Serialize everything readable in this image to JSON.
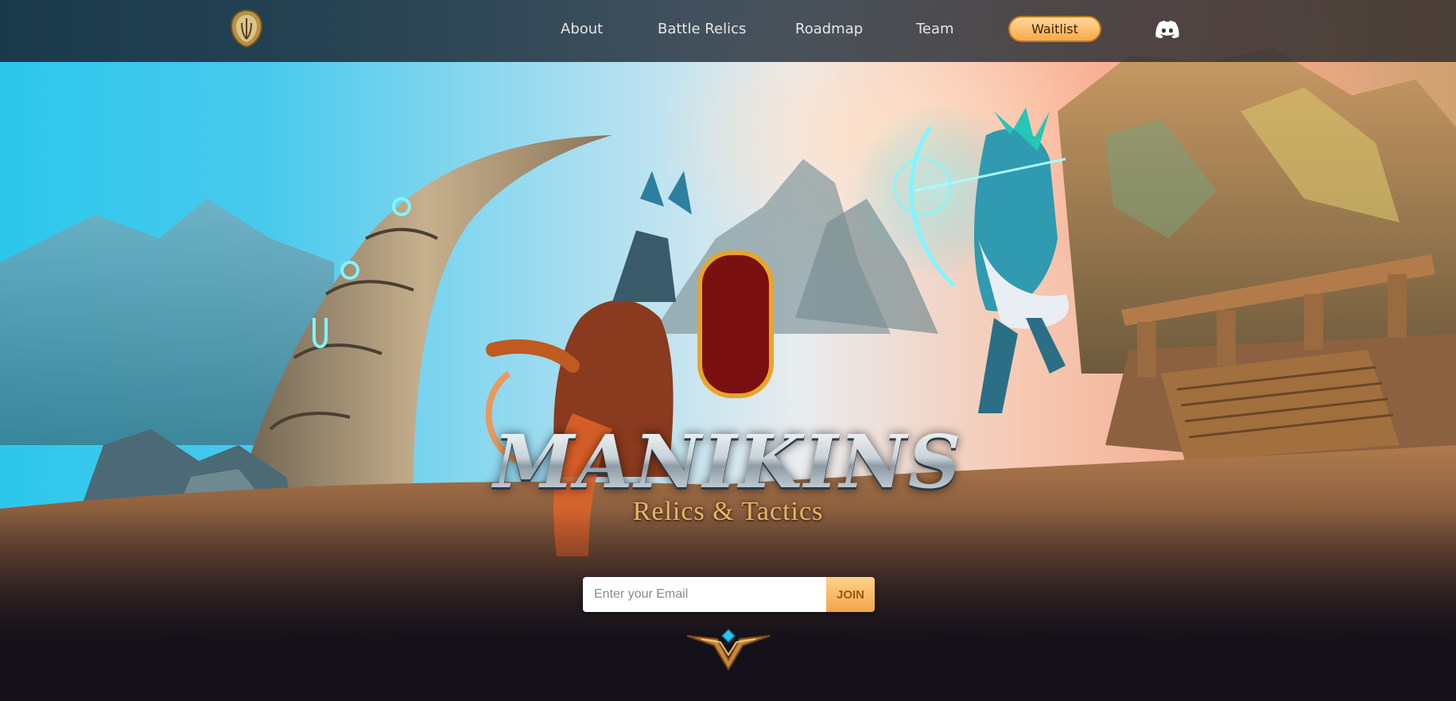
{
  "nav": {
    "logo_icon": "shield-emblem-icon",
    "links": [
      {
        "label": "About"
      },
      {
        "label": "Battle Relics"
      },
      {
        "label": "Roadmap"
      },
      {
        "label": "Team"
      }
    ],
    "waitlist_label": "Waitlist",
    "discord_icon": "discord-icon"
  },
  "hero": {
    "title": "MANIKINS",
    "subtitle": "Relics & Tactics"
  },
  "signup": {
    "email_placeholder": "Enter your Email",
    "email_value": "",
    "join_label": "JOIN"
  },
  "colors": {
    "accent_gold": "#f6a94a",
    "nav_bg": "#1e2a36",
    "page_bg": "#14111a"
  }
}
